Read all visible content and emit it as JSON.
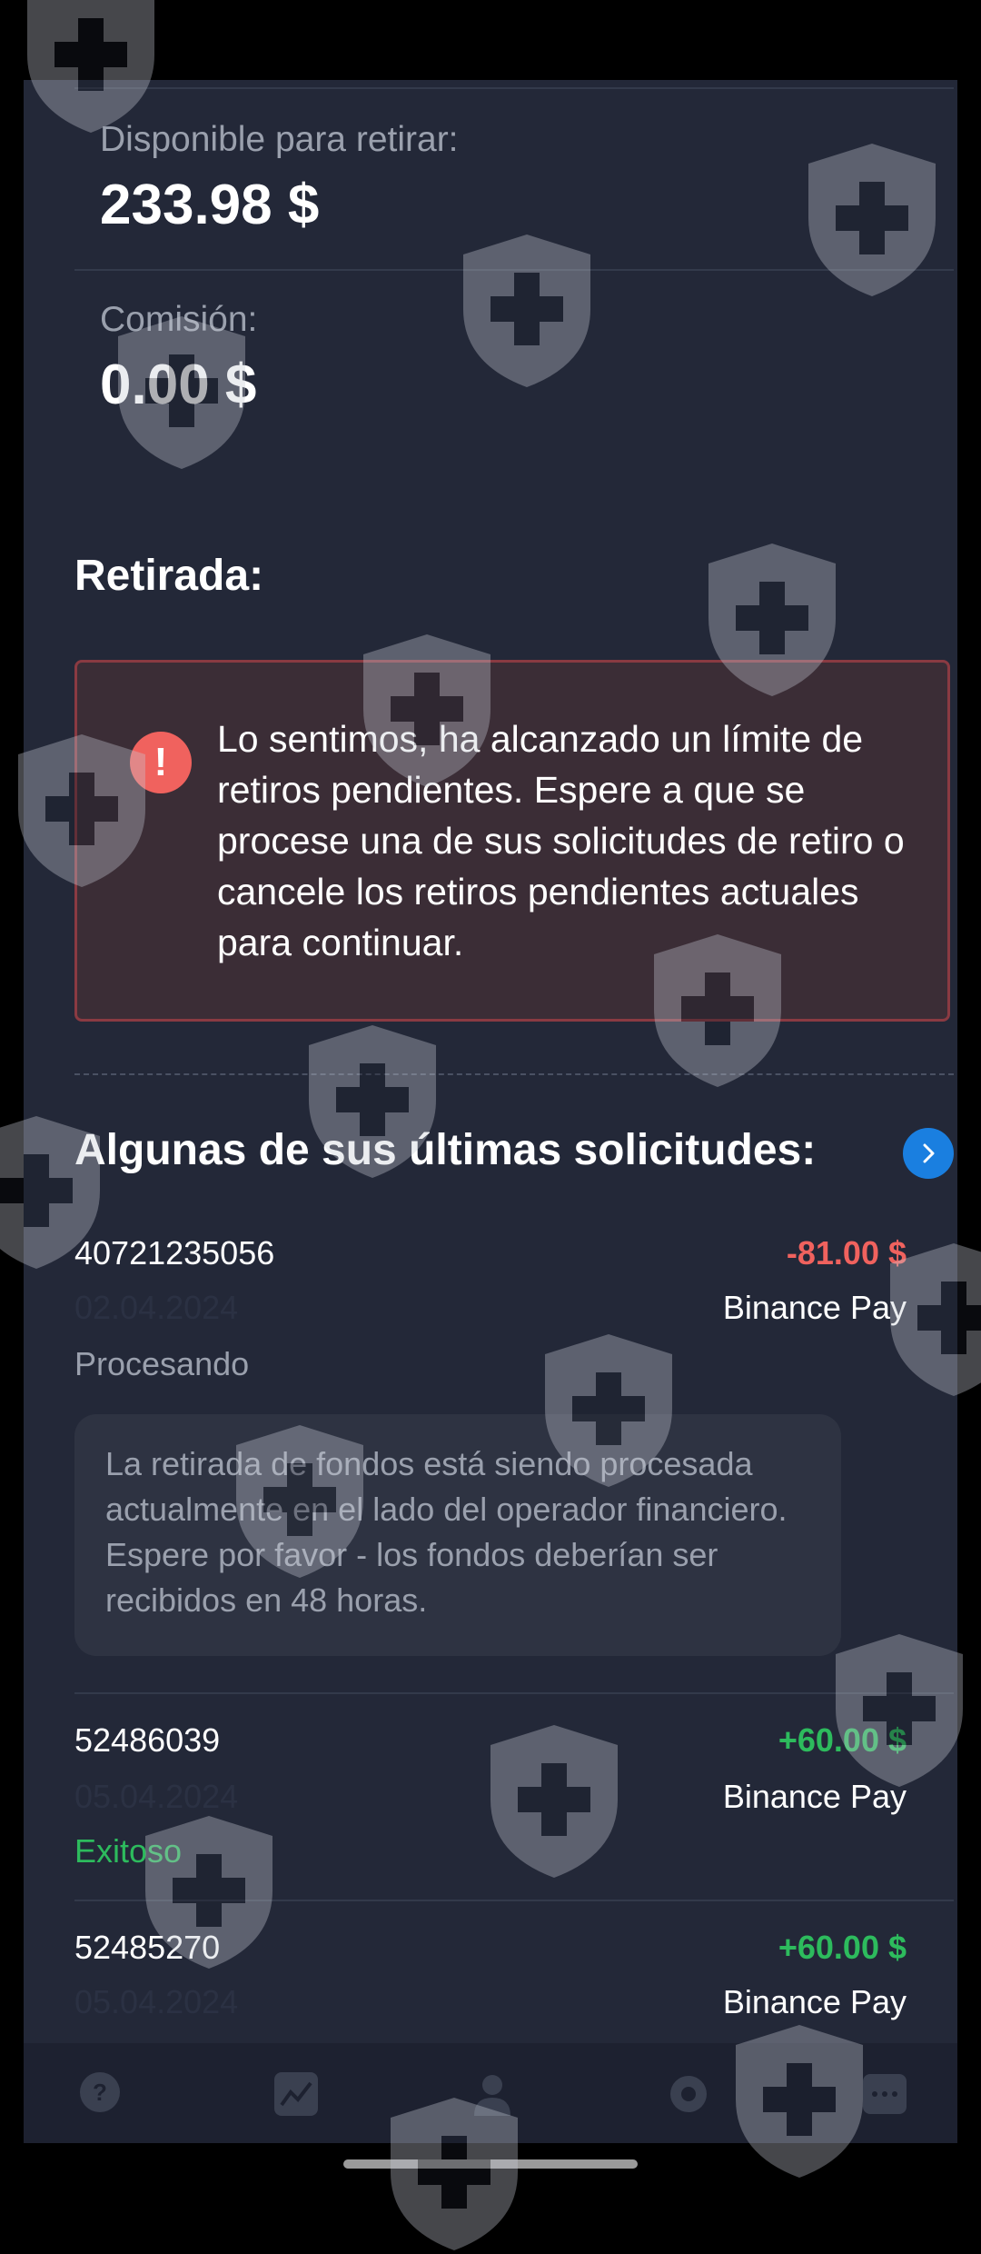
{
  "balance": {
    "available_label": "Disponible para retirar:",
    "available_value": "233.98 $",
    "commission_label": "Comisión:",
    "commission_value": "0.00 $"
  },
  "withdrawal": {
    "title": "Retirada:",
    "error_message": "Lo sentimos, ha alcanzado un límite de retiros pendientes. Espere a que se procese una de sus solicitudes de retiro o cancele los retiros pendientes actuales para continuar."
  },
  "requests": {
    "title": "Algunas de sus últimas solicitudes:",
    "items": [
      {
        "id": "40721235056",
        "date": "02.04.2024",
        "status": "Procesando",
        "amount": "-81.00 $",
        "method": "Binance Pay",
        "info": "La retirada de fondos está siendo procesada actualmente en el lado del operador financiero. Espere por favor - los fondos deberían ser recibidos en 48 horas."
      },
      {
        "id": "52486039",
        "date": "05.04.2024",
        "status": "Exitoso",
        "amount": "+60.00 $",
        "method": "Binance Pay"
      },
      {
        "id": "52485270",
        "date": "05.04.2024",
        "amount": "+60.00 $",
        "method": "Binance Pay"
      }
    ]
  },
  "colors": {
    "negative": "#f0625e",
    "positive": "#2dbb5d",
    "accent": "#1a7fe0",
    "panel": "#232838"
  },
  "nav": {
    "items": [
      "help-icon",
      "chart-icon",
      "profile-icon",
      "settings-icon",
      "chat-icon"
    ]
  }
}
